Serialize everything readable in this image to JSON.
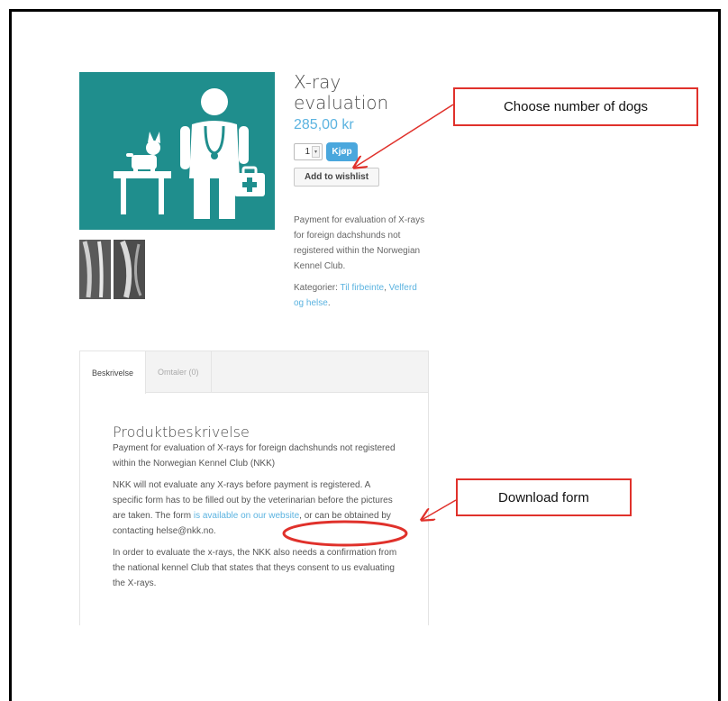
{
  "product": {
    "title_line1": "X-ray",
    "title_line2": "evaluation",
    "price": "285,00 kr",
    "quantity": "1",
    "qty_spin_glyph": "▾",
    "buy_label": "Kjøp",
    "wishlist_label": "Add to wishlist",
    "short_description": "Payment for evaluation of X-rays for foreign dachshunds not registered within the Norwegian Kennel Club.",
    "categories_label": "Kategorier: ",
    "categories": [
      "Til firbeinte",
      "Velferd og helse"
    ],
    "categories_sep": ", ",
    "categories_end": "."
  },
  "tabs": [
    {
      "label": "Beskrivelse"
    },
    {
      "label": "Omtaler (0)"
    }
  ],
  "description": {
    "heading": "Produktbeskrivelse",
    "p1": "Payment for evaluation of X-rays for foreign dachshunds not registered within the Norwegian Kennel Club (NKK)",
    "p2_before": "NKK will not evaluate any X-rays before payment is registered. A specific form has to be filled out by the veterinarian before the pictures are taken. The form ",
    "p2_link": "is available on our website",
    "p2_after": ", or can be obtained by contacting helse@nkk.no.",
    "p3": "In order to evaluate the x-rays, the NKK also needs a confirmation from the national kennel Club that states that theys consent to us evaluating the X-rays."
  },
  "annotations": {
    "choose_dogs": "Choose number of dogs",
    "download_form": "Download form",
    "color": "#e0312b"
  },
  "colors": {
    "image_bg": "#1f8e8d",
    "accent": "#5bb3e0",
    "buy_button": "#4aa7dd"
  },
  "icons": [
    "veterinarian-icon",
    "dog-icon",
    "medical-kit-icon",
    "xray-thumbnail"
  ]
}
